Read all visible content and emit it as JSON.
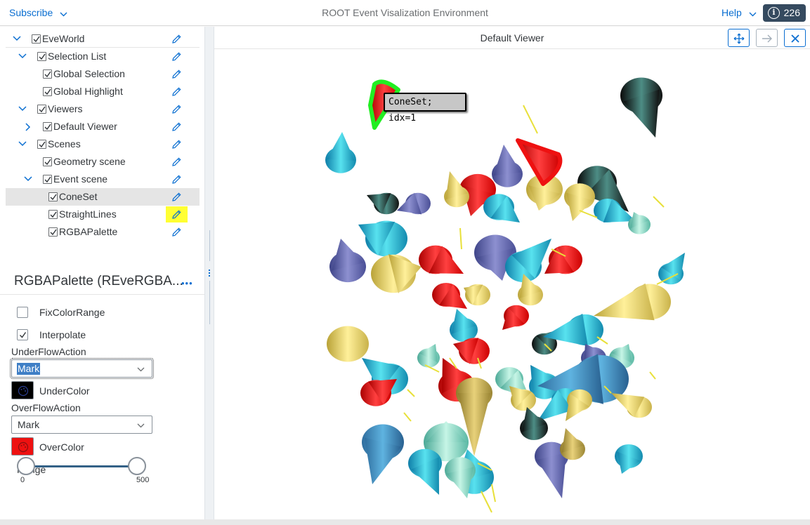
{
  "topbar": {
    "subscribe_label": "Subscribe",
    "title": "ROOT Event Visalization Environment",
    "help_label": "Help",
    "count": "226",
    "info_glyph": "i"
  },
  "tree": [
    {
      "label": "EveWorld",
      "depth": 0,
      "expanded": true,
      "checked": true
    },
    {
      "label": "Selection List",
      "depth": 1,
      "expanded": true,
      "checked": true
    },
    {
      "label": "Global Selection",
      "depth": 2,
      "expanded": null,
      "checked": true
    },
    {
      "label": "Global Highlight",
      "depth": 2,
      "expanded": null,
      "checked": true
    },
    {
      "label": "Viewers",
      "depth": 1,
      "expanded": true,
      "checked": true
    },
    {
      "label": "Default Viewer",
      "depth": 2,
      "expanded": false,
      "checked": true
    },
    {
      "label": "Scenes",
      "depth": 1,
      "expanded": true,
      "checked": true
    },
    {
      "label": "Geometry scene",
      "depth": 2,
      "expanded": null,
      "checked": true
    },
    {
      "label": "Event scene",
      "depth": 2,
      "expanded": true,
      "checked": true
    },
    {
      "label": "ConeSet",
      "depth": 3,
      "expanded": null,
      "checked": true,
      "selected": true
    },
    {
      "label": "StraightLines",
      "depth": 3,
      "expanded": null,
      "checked": true,
      "highlighted_edit": true
    },
    {
      "label": "RGBAPalette",
      "depth": 3,
      "expanded": null,
      "checked": true
    }
  ],
  "editor": {
    "title": "RGBAPalette (REveRGBA...",
    "more_label": "•••",
    "fix_color_range": {
      "label": "FixColorRange",
      "checked": false
    },
    "interpolate": {
      "label": "Interpolate",
      "checked": true
    },
    "underflow_action": {
      "label": "UnderFlowAction",
      "value": "Mark"
    },
    "under_color": {
      "label": "UnderColor",
      "color": "#000000"
    },
    "overflow_action": {
      "label": "OverFlowAction",
      "value": "Mark"
    },
    "over_color": {
      "label": "OverColor",
      "color": "#ee1111"
    },
    "range": {
      "label": "Range",
      "min_label": "0",
      "max_label": "500",
      "low": 15,
      "high": 475,
      "min": 0,
      "max": 500
    }
  },
  "viewer": {
    "title": "Default Viewer",
    "tooltip": "ConeSet; idx=1"
  },
  "colors": {
    "accent": "#0a6ed1",
    "badge_bg": "#354a5f",
    "highlight_yellow": "#ffff33",
    "selection_green": "#22ee22",
    "selection_red": "#ee1111"
  }
}
